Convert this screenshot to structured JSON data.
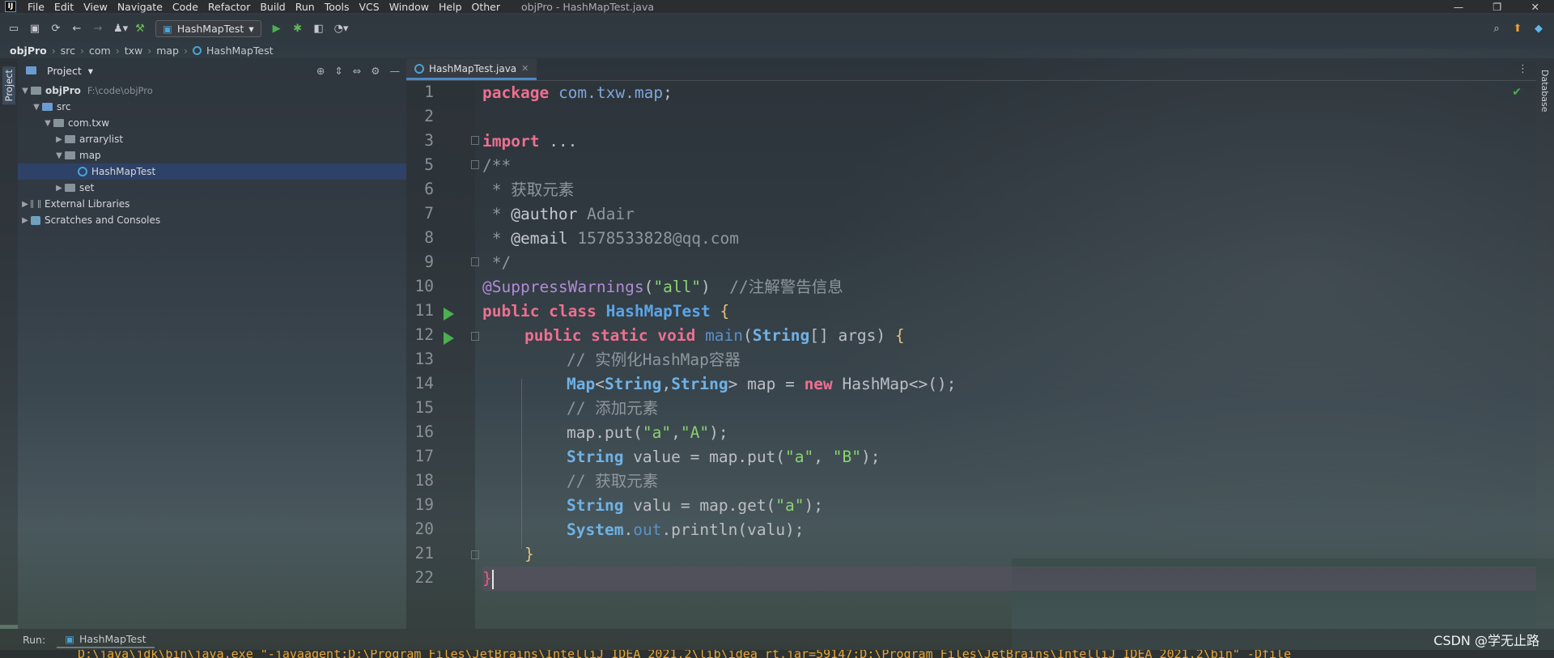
{
  "menubar": {
    "items": [
      "File",
      "Edit",
      "View",
      "Navigate",
      "Code",
      "Refactor",
      "Build",
      "Run",
      "Tools",
      "VCS",
      "Window",
      "Help",
      "Other"
    ],
    "window_title": "objPro - HashMapTest.java",
    "controls": [
      "—",
      "❐",
      "✕"
    ]
  },
  "toolbar": {
    "run_config": "HashMapTest"
  },
  "breadcrumb": [
    "objPro",
    "src",
    "com",
    "txw",
    "map",
    "HashMapTest"
  ],
  "leftstripe": {
    "label": "Project"
  },
  "project": {
    "header": "Project",
    "tree": [
      {
        "label": "objPro",
        "path": "F:\\code\\objPro"
      },
      {
        "label": "src"
      },
      {
        "label": "com.txw"
      },
      {
        "label": "arrarylist"
      },
      {
        "label": "map"
      },
      {
        "label": "HashMapTest"
      },
      {
        "label": "set"
      },
      {
        "label": "External Libraries"
      },
      {
        "label": "Scratches and Consoles"
      }
    ]
  },
  "editor": {
    "tab": "HashMapTest.java",
    "line_numbers": [
      "1",
      "2",
      "3",
      "5",
      "6",
      "7",
      "8",
      "9",
      "10",
      "11",
      "12",
      "13",
      "14",
      "15",
      "16",
      "17",
      "18",
      "19",
      "20",
      "21",
      "22"
    ],
    "code": {
      "l1_kw": "package",
      "l1_pk": "com.txw.map",
      "l1_end": ";",
      "l3_kw": "import",
      "l3_rest": " ...",
      "l5": "/**",
      "l6": " * 获取元素",
      "l7_a": " * ",
      "l7_tag": "@author",
      "l7_val": " Adair",
      "l8_a": " * ",
      "l8_tag": "@email",
      "l8_val": " 1578533828@qq.com",
      "l9": " */",
      "l10_ann": "@SuppressWarnings",
      "l10_p1": "(",
      "l10_str": "\"all\"",
      "l10_p2": ")",
      "l10_cm": "  //注解警告信息",
      "l11_kw": "public class ",
      "l11_cls": "HashMapTest",
      "l11_br": " {",
      "l12_kw": "public static void ",
      "l12_fn": "main",
      "l12_p": "(",
      "l12_ty": "String",
      "l12_rest": "[] args) ",
      "l12_br": "{",
      "l13": "// 实例化HashMap容器",
      "l14_ty1": "Map",
      "l14_a": "<",
      "l14_ty2": "String",
      "l14_b": ",",
      "l14_ty3": "String",
      "l14_c": "> map = ",
      "l14_kw": "new",
      "l14_d": " HashMap<>();",
      "l15": "// 添加元素",
      "l16_a": "map.put(",
      "l16_s1": "\"a\"",
      "l16_b": ",",
      "l16_s2": "\"A\"",
      "l16_c": ");",
      "l17_ty": "String",
      "l17_a": " value = map.put(",
      "l17_s1": "\"a\"",
      "l17_b": ", ",
      "l17_s2": "\"B\"",
      "l17_c": ");",
      "l18": "// 获取元素",
      "l19_ty": "String",
      "l19_a": " valu = map.get(",
      "l19_s": "\"a\"",
      "l19_b": ");",
      "l20_ty": "System",
      "l20_a": ".",
      "l20_out": "out",
      "l20_b": ".println(valu);",
      "l21": "}",
      "l22": "}"
    }
  },
  "rightstripe": {
    "label": "Database"
  },
  "runbar": {
    "label": "Run:",
    "tab": "HashMapTest",
    "watermark": "CSDN @学无止路"
  },
  "console": {
    "text": "D:\\java\\jdk\\bin\\java.exe \"-javaagent:D:\\Program Files\\JetBrains\\IntelliJ IDEA 2021.2\\lib\\idea_rt.jar=59147:D:\\Program Files\\JetBrains\\IntelliJ IDEA 2021.2\\bin\" -Dfile"
  }
}
